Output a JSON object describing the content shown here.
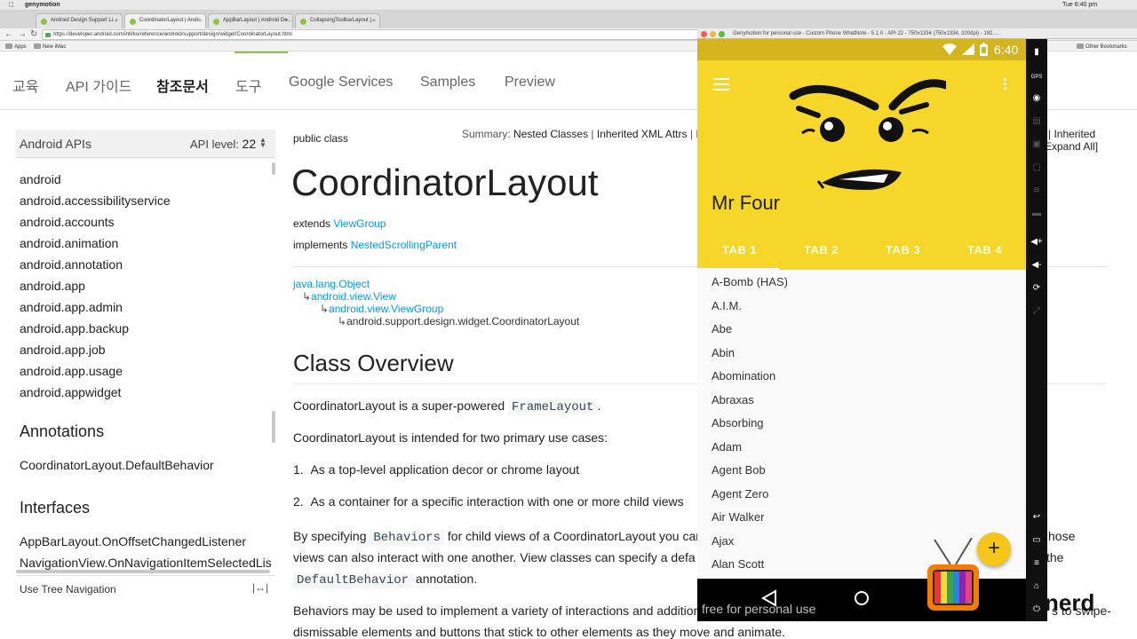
{
  "mac": {
    "app": "genymotion",
    "clock": "Tue 6:40 pm"
  },
  "browser": {
    "tabs": [
      "Android Design Support Li...",
      "CoordinatorLayout | Andr...",
      "AppBarLayout | Android De...",
      "CollapsingToolbarLayout |..."
    ],
    "url": "https://developer.android.com/intl/ko/reference/android/support/design/widget/CoordinatorLayout.html",
    "bookmarks": {
      "apps": "Apps",
      "new_imac": "New iMac",
      "other": "Other Bookmarks"
    }
  },
  "site_nav": [
    "교육",
    "API 가이드",
    "참조문서",
    "도구",
    "Google Services",
    "Samples",
    "Preview"
  ],
  "sidebar": {
    "title": "Android APIs",
    "api_level_label": "API level:",
    "api_level": "22",
    "packages": [
      "android",
      "android.accessibilityservice",
      "android.accounts",
      "android.animation",
      "android.annotation",
      "android.app",
      "android.app.admin",
      "android.app.backup",
      "android.app.job",
      "android.app.usage",
      "android.appwidget"
    ],
    "annotations_title": "Annotations",
    "annotations": [
      "CoordinatorLayout.DefaultBehavior"
    ],
    "interfaces_title": "Interfaces",
    "interfaces": [
      "AppBarLayout.OnOffsetChangedListener",
      "NavigationView.OnNavigationItemSelectedLis"
    ],
    "tree_nav": "Use Tree Navigation"
  },
  "doc": {
    "public_class": "public class",
    "summary_label": "Summary:",
    "summary_link1": "Nested Classes",
    "summary_link2": "Inherited XML Attrs",
    "summary_right1": "| Inherited",
    "summary_right2": "Expand All]",
    "class_name": "CoordinatorLayout",
    "extends_label": "extends",
    "extends_value": "ViewGroup",
    "implements_label": "implements",
    "implements_value": "NestedScrollingParent",
    "hierarchy": [
      "java.lang.Object",
      "android.view.View",
      "android.view.ViewGroup",
      "android.support.design.widget.CoordinatorLayout"
    ],
    "overview_title": "Class Overview",
    "p1_a": "CoordinatorLayout is a super-powered",
    "p1_code": "FrameLayout",
    "p1_b": ".",
    "p2": "CoordinatorLayout is intended for two primary use cases:",
    "li1": "As a top-level application decor or chrome layout",
    "li2": "As a container for a specific interaction with one or more child views",
    "p3_a": "By specifying",
    "p3_code": "Behaviors",
    "p3_b": "for child views of a CoordinatorLayout you can",
    "p3_right": "hose",
    "p4_a": "views can also interact with one another. View classes can specify a defa",
    "p4_right": "the",
    "p5_code": "DefaultBehavior",
    "p5_b": "annotation.",
    "p6": "Behaviors may be used to implement a variety of interactions and addition",
    "p6_right": "s to swipe-",
    "p7": "dismissable elements and buttons that stick to other elements as they move and animate."
  },
  "emulator": {
    "title": "Genymotion for personal use - Custom Phone WhatNote - 5.1.0 - API 22 - 750x1334 (750x1334, 320dpi) - 192....",
    "time": "6:40",
    "app_title": "Mr Four",
    "tabs": [
      "TAB 1",
      "TAB 2",
      "TAB 3",
      "TAB 4"
    ],
    "list": [
      "A-Bomb (HAS)",
      "A.I.M.",
      "Abe",
      "Abin",
      "Abomination",
      "Abraxas",
      "Absorbing",
      "Adam",
      "Agent Bob",
      "Agent Zero",
      "Air Walker",
      "Ajax",
      "Alan Scott"
    ],
    "fab": "+",
    "watermark": "free for personal use",
    "side_gps": "GPS"
  },
  "brand": "nerd",
  "colors": {
    "accent_yellow": "#f5d629",
    "status_yellow": "#d4b51d",
    "link_blue": "#039be5",
    "fab": "#f5c518"
  }
}
